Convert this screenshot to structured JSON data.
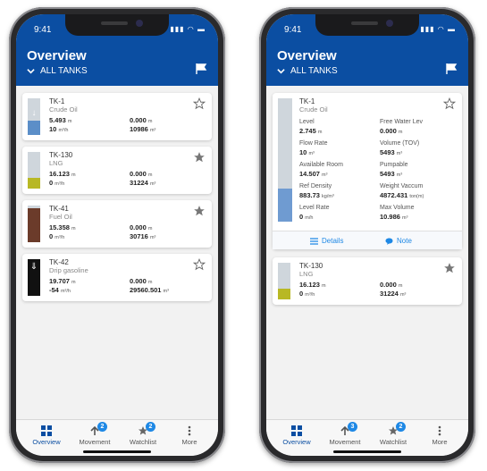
{
  "status": {
    "time": "9:41",
    "icons": "signal-wifi-battery-icons"
  },
  "header": {
    "title": "Overview",
    "filter": "ALL TANKS"
  },
  "colors": {
    "brand": "#0b4ea2",
    "badge": "#1e88e5",
    "crude": "#5b8ec8",
    "lng": "#b8b824",
    "fuel": "#6b3b2a",
    "drip": "#111111"
  },
  "left": {
    "tanks": [
      {
        "name": "TK-1",
        "product": "Crude Oil",
        "level": "5.493",
        "level_unit": "m",
        "free_water": "0.000",
        "free_water_unit": "m",
        "flow": "10",
        "flow_unit": "m³/h",
        "volume": "10986",
        "volume_unit": "m³",
        "starred": false,
        "fill_pct": 0.5,
        "direction": "down"
      },
      {
        "name": "TK-130",
        "product": "LNG",
        "level": "16.123",
        "level_unit": "m",
        "free_water": "0.000",
        "free_water_unit": "m",
        "flow": "0",
        "flow_unit": "m³/h",
        "volume": "31224",
        "volume_unit": "m³",
        "starred": true,
        "fill_pct": 0.33,
        "direction": "none"
      },
      {
        "name": "TK-41",
        "product": "Fuel Oil",
        "level": "15.358",
        "level_unit": "m",
        "free_water": "0.000",
        "free_water_unit": "m",
        "flow": "0",
        "flow_unit": "m³/h",
        "volume": "30716",
        "volume_unit": "m³",
        "starred": true,
        "fill_pct": 0.92,
        "direction": "none"
      },
      {
        "name": "TK-42",
        "product": "Drip gasoline",
        "level": "19.707",
        "level_unit": "m",
        "free_water": "0.000",
        "free_water_unit": "m",
        "flow": "-54",
        "flow_unit": "m³/h",
        "volume": "29560.501",
        "volume_unit": "m³",
        "starred": false,
        "fill_pct": 1.0,
        "direction": "down"
      }
    ]
  },
  "right": {
    "expanded": {
      "name": "TK-1",
      "product": "Crude Oil",
      "fields": [
        {
          "label": "Level",
          "value": "2.745",
          "unit": "m"
        },
        {
          "label": "Free Water Lev",
          "value": "0.000",
          "unit": "m"
        },
        {
          "label": "Flow Rate",
          "value": "10",
          "unit": "m³"
        },
        {
          "label": "Volume (TOV)",
          "value": "5493",
          "unit": "m³"
        },
        {
          "label": "Available Room",
          "value": "14.507",
          "unit": "m³"
        },
        {
          "label": "Pumpable",
          "value": "5493",
          "unit": "m³"
        },
        {
          "label": "Ref Density",
          "value": "883.73",
          "unit": "kg/m³"
        },
        {
          "label": "Weight Vaccum",
          "value": "4872.431",
          "unit": "ton(m)"
        },
        {
          "label": "Level Rate",
          "value": "0",
          "unit": "m/h"
        },
        {
          "label": "Max Volume",
          "value": "10.986",
          "unit": "m³"
        }
      ],
      "details_label": "Details",
      "note_label": "Note",
      "starred": false,
      "fill_pct": 0.27
    },
    "tank": {
      "name": "TK-130",
      "product": "LNG",
      "level": "16.123",
      "level_unit": "m",
      "free_water": "0.000",
      "free_water_unit": "m",
      "flow": "0",
      "flow_unit": "m³/h",
      "volume": "31224",
      "volume_unit": "m³",
      "starred": true,
      "fill_pct": 0.33
    }
  },
  "tabs": [
    {
      "label": "Overview",
      "icon": "grid-icon",
      "badge": ""
    },
    {
      "label": "Movement",
      "icon": "arrow-up-icon",
      "badge": "2"
    },
    {
      "label": "Watchlist",
      "icon": "star-icon",
      "badge": "2"
    },
    {
      "label": "More",
      "icon": "more-vertical-icon",
      "badge": ""
    }
  ],
  "tabs_right_badges": {
    "movement": "3",
    "watchlist": "2"
  }
}
